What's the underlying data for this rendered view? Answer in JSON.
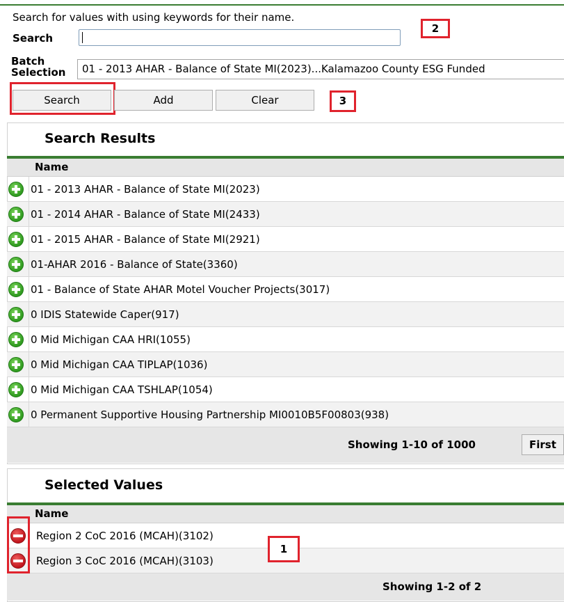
{
  "search_area": {
    "instructions": "Search for values with using keywords for their name.",
    "search_label": "Search",
    "search_value": "",
    "batch_label_line1": "Batch",
    "batch_label_line2": "Selection",
    "batch_value": "01 - 2013 AHAR - Balance of State MI(2023)...Kalamazoo County ESG Funded",
    "buttons": {
      "search": "Search",
      "add": "Add",
      "clear": "Clear"
    }
  },
  "callouts": {
    "one": "1",
    "two": "2",
    "three": "3"
  },
  "search_results": {
    "title": "Search Results",
    "column": "Name",
    "rows": [
      "01 - 2013 AHAR - Balance of State MI(2023)",
      "01 - 2014 AHAR - Balance of State MI(2433)",
      "01 - 2015 AHAR - Balance of State MI(2921)",
      "01-AHAR 2016 - Balance of State(3360)",
      "01 - Balance of State AHAR Motel Voucher Projects(3017)",
      "0 IDIS Statewide Caper(917)",
      "0 Mid Michigan CAA HRI(1055)",
      "0 Mid Michigan CAA TIPLAP(1036)",
      "0 Mid Michigan CAA TSHLAP(1054)",
      "0 Permanent Supportive Housing Partnership MI0010B5F00803(938)"
    ],
    "showing": "Showing 1-10 of 1000",
    "first_button": "First"
  },
  "selected_values": {
    "title": "Selected Values",
    "column": "Name",
    "rows": [
      "Region 2 CoC 2016 (MCAH)(3102)",
      "Region 3 CoC 2016 (MCAH)(3103)"
    ],
    "showing": "Showing 1-2 of 2"
  },
  "colors": {
    "accent_green": "#3a7d32",
    "highlight_red": "#e0232d"
  },
  "icons": {
    "add_row": "plus-circle-icon",
    "remove_row": "minus-circle-icon"
  }
}
